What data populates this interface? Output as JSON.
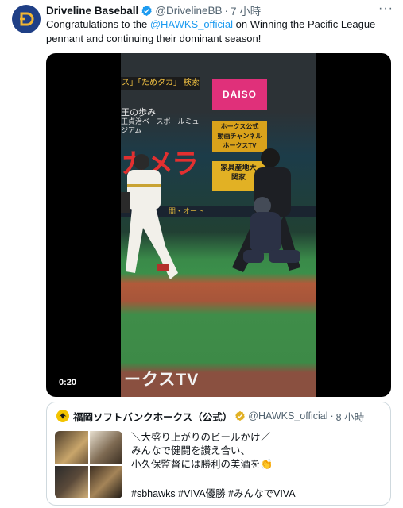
{
  "tweet": {
    "display_name": "Driveline Baseball",
    "handle": "@DrivelineBB",
    "time": "7 小時",
    "text_before": "Congratulations to the ",
    "mention": "@HAWKS_official",
    "text_after": " on Winning the Pacific League pennant and continuing their dominant season!",
    "more_label": "···"
  },
  "video": {
    "timestamp": "0:20",
    "signs": {
      "strip": "ス」「ためタカ」 検索",
      "museum_line1": "王の歩み",
      "museum_line2": "王貞治ベースボールミュージアム",
      "daiso": "DAISO",
      "hawks_channel_1": "ホークス公式",
      "hawks_channel_2": "動画チャンネル",
      "hawks_channel_3": "ホークスTV",
      "camera": "カメラ",
      "furniture_1": "家具産地大",
      "furniture_2": "関家",
      "wall": "間・オート",
      "field_logo": "ークスTV"
    }
  },
  "quote": {
    "display_name": "福岡ソフトバンクホークス（公式）",
    "handle": "@HAWKS_official",
    "time": "8 小時",
    "lines": [
      "＼大盛り上がりのビールかけ／",
      "みんなで健闘を讃え合い、",
      "小久保監督には勝利の美酒を👏"
    ],
    "hashtags": "#sbhawks #VIVA優勝 #みんなでVIVA"
  },
  "colors": {
    "link": "#1d9bf0",
    "verified": "#1d9bf0",
    "secondary_text": "#536471",
    "avatar_bg": "#1f3f86"
  },
  "icons": {
    "verified": "verified-badge-icon",
    "more": "more-icon",
    "avatar": "driveline-logo",
    "quote_avatar": "hawks-logo"
  }
}
